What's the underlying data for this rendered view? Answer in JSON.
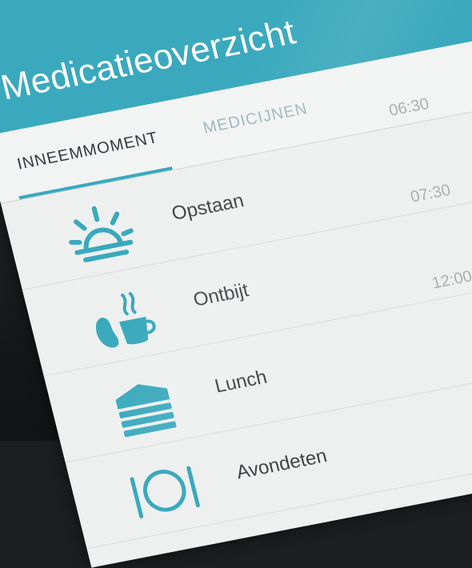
{
  "app": {
    "title": "Medicatieoverzicht"
  },
  "tabs": [
    {
      "label": "INNEEMMOMENT",
      "active": true
    },
    {
      "label": "MEDICIJNEN",
      "active": false
    }
  ],
  "moments": [
    {
      "label": "Opstaan",
      "time": "06:30",
      "icon": "sunrise-icon"
    },
    {
      "label": "Ontbijt",
      "time": "07:30",
      "icon": "breakfast-icon"
    },
    {
      "label": "Lunch",
      "time": "12:00",
      "icon": "lunch-icon"
    },
    {
      "label": "Avondeten",
      "time": "",
      "icon": "dinner-icon"
    }
  ],
  "colors": {
    "accent": "#3aa9bd",
    "icon": "#3aa9bd",
    "background": "#eef0ef"
  }
}
